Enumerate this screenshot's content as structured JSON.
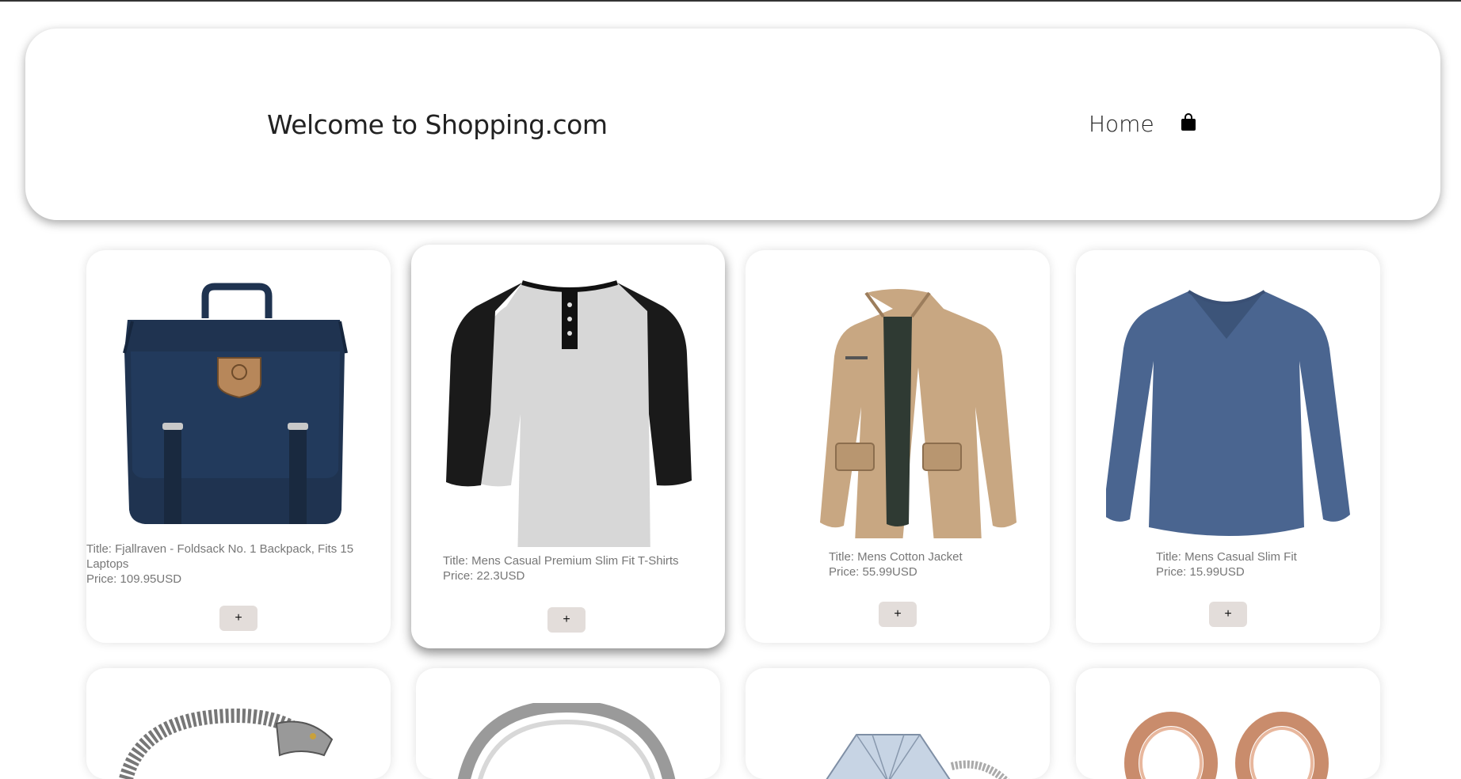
{
  "header": {
    "welcome_text": "Welcome to Shopping.com",
    "nav_home": "Home",
    "cart_icon": "shopping-bag-icon"
  },
  "products": [
    {
      "title": "Title: Fjallraven - Foldsack No. 1 Backpack, Fits 15 Laptops",
      "price": "Price: 109.95USD",
      "add_label": "+",
      "image": "backpack"
    },
    {
      "title": "Title: Mens Casual Premium Slim Fit T-Shirts",
      "price": "Price: 22.3USD",
      "add_label": "+",
      "image": "raglan-tshirt"
    },
    {
      "title": "Title: Mens Cotton Jacket",
      "price": "Price: 55.99USD",
      "add_label": "+",
      "image": "cotton-jacket"
    },
    {
      "title": "Title: Mens Casual Slim Fit",
      "price": "Price: 15.99USD",
      "add_label": "+",
      "image": "long-sleeve-shirt"
    },
    {
      "image": "dragon-bracelet"
    },
    {
      "image": "silver-ring"
    },
    {
      "image": "diamond-ring"
    },
    {
      "image": "rose-gold-earrings"
    }
  ],
  "colors": {
    "button_bg": "#e3ddda",
    "text_muted": "#777777",
    "backpack": "#1f3350",
    "shirt_blue": "#4a6590",
    "jacket_tan": "#c8a782"
  }
}
